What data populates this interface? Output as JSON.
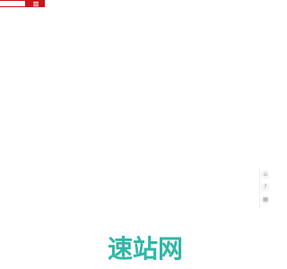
{
  "colors": {
    "topbar": "#c9151e",
    "logo": "#2fb7a5",
    "tool_icons": "#9a9a9a"
  },
  "header": {
    "menu_icon": "menu-icon"
  },
  "side_tools": {
    "items": [
      {
        "icon": "home-icon",
        "glyph": "⌂"
      },
      {
        "icon": "help-icon",
        "glyph": "?"
      },
      {
        "icon": "qr-icon",
        "glyph": "▦"
      }
    ]
  },
  "footer": {
    "logo_text": "速站网"
  }
}
